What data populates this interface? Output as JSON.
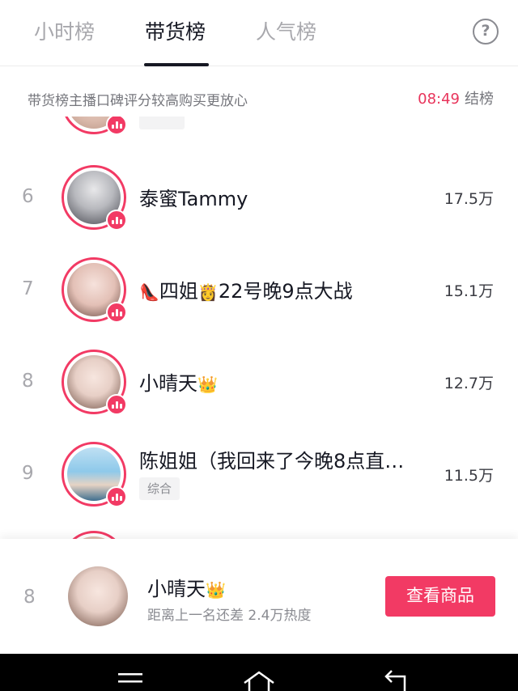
{
  "tabs": [
    {
      "label": "小时榜",
      "active": false
    },
    {
      "label": "带货榜",
      "active": true
    },
    {
      "label": "人气榜",
      "active": false
    }
  ],
  "help_icon": "question-circle-icon",
  "subbar": {
    "text": "带货榜主播口碑评分较高购买更放心",
    "time": "08:49",
    "suffix": "结榜"
  },
  "rows": [
    {
      "rank": "6",
      "name": "泰蜜Tammy",
      "score": "17.5万"
    },
    {
      "rank": "7",
      "name_prefix_icon": "high-heel-emoji",
      "name": "四姐",
      "name_mid_icon": "princess-emoji",
      "name_suffix": "22号晚9点大战",
      "score": "15.1万"
    },
    {
      "rank": "8",
      "name": "小晴天",
      "name_icon": "crown-emoji",
      "score": "12.7万"
    },
    {
      "rank": "9",
      "name": "陈姐姐（我回来了今晚8点直…",
      "score": "11.5万",
      "tag": "综合"
    }
  ],
  "footer": {
    "rank": "8",
    "name": "小晴天",
    "gap_text": "距离上一名还差 2.4万热度",
    "button_label": "查看商品"
  },
  "colors": {
    "accent": "#f23a64",
    "countdown": "#e8345b"
  }
}
